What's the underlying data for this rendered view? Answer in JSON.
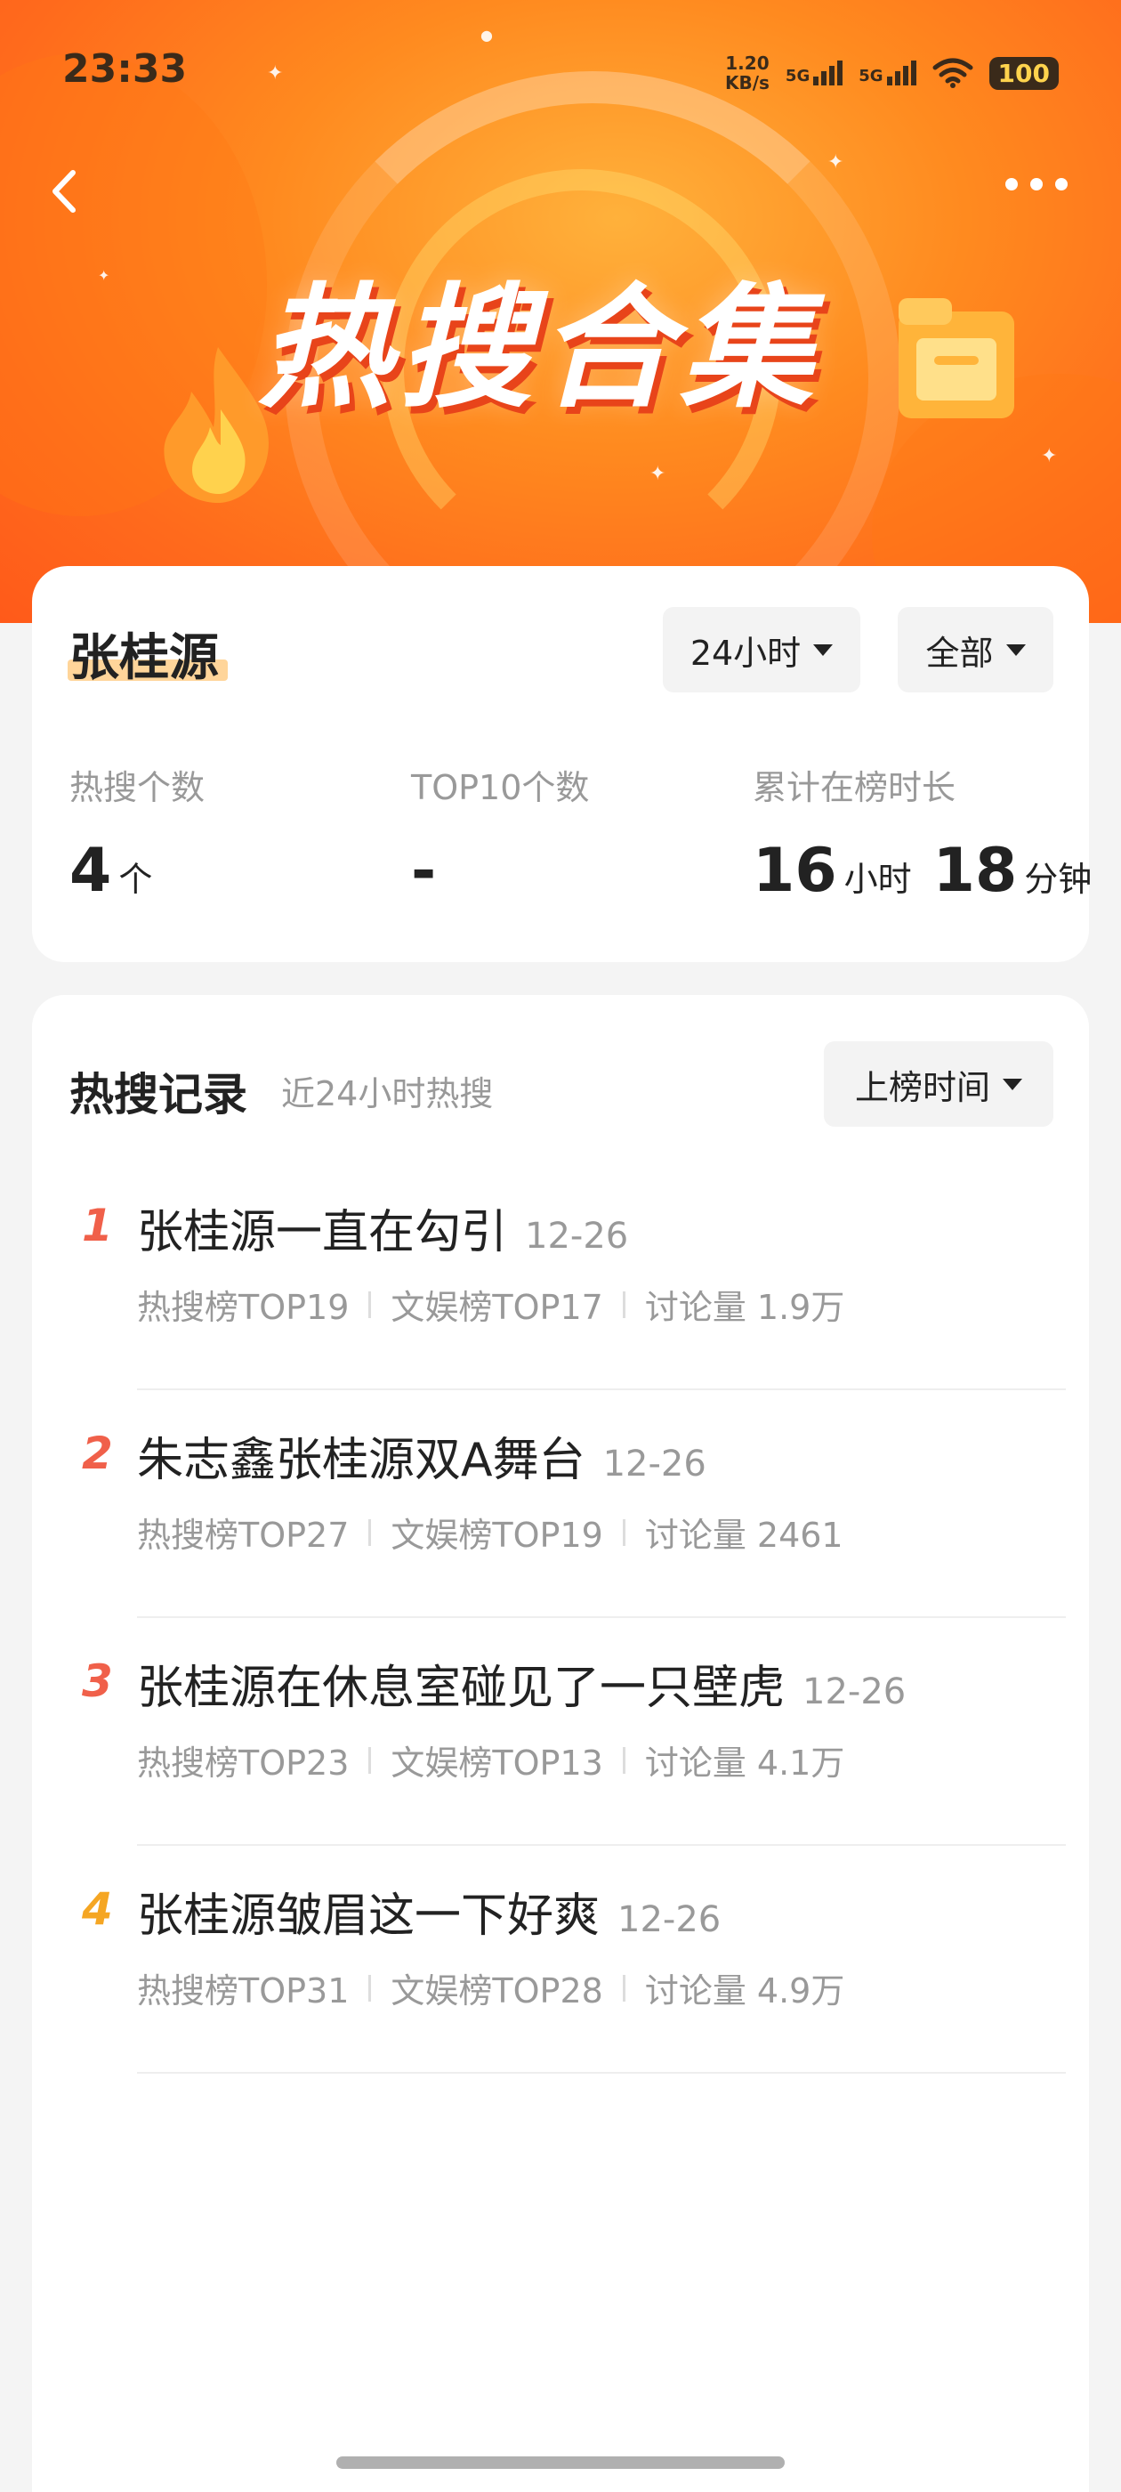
{
  "status_bar": {
    "time": "23:33",
    "net_speed_value": "1.20",
    "net_speed_unit": "KB/s",
    "signal1": "5G",
    "signal2": "5G",
    "battery": "100"
  },
  "banner": {
    "title": "热搜合集"
  },
  "summary": {
    "topic": "张桂源",
    "time_filter": "24小时",
    "category_filter": "全部",
    "stats": [
      {
        "label": "热搜个数",
        "value": "4",
        "unit": "个"
      },
      {
        "label": "TOP10个数",
        "value": "-",
        "unit": ""
      },
      {
        "label": "累计在榜时长",
        "hours": "16",
        "hours_unit": "小时",
        "minutes": "18",
        "minutes_unit": "分钟"
      }
    ]
  },
  "records": {
    "title": "热搜记录",
    "subtitle": "近24小时热搜",
    "sort_label": "上榜时间",
    "items": [
      {
        "rank": "1",
        "title": "张桂源一直在勾引",
        "date": "12-26",
        "hot_rank": "热搜榜TOP19",
        "ent_rank": "文娱榜TOP17",
        "discussion": "讨论量 1.9万"
      },
      {
        "rank": "2",
        "title": "朱志鑫张桂源双A舞台",
        "date": "12-26",
        "hot_rank": "热搜榜TOP27",
        "ent_rank": "文娱榜TOP19",
        "discussion": "讨论量 2461"
      },
      {
        "rank": "3",
        "title": "张桂源在休息室碰见了一只壁虎",
        "date": "12-26",
        "hot_rank": "热搜榜TOP23",
        "ent_rank": "文娱榜TOP13",
        "discussion": "讨论量 4.1万"
      },
      {
        "rank": "4",
        "title": "张桂源皱眉这一下好爽",
        "date": "12-26",
        "hot_rank": "热搜榜TOP31",
        "ent_rank": "文娱榜TOP28",
        "discussion": "讨论量 4.9万"
      }
    ]
  },
  "colors": {
    "rank_1": "#f0604a",
    "rank_2": "#f0604a",
    "rank_3": "#f0604a",
    "rank_4": "#f5a623",
    "banner_orange": "#ff7a1c"
  },
  "icons": {
    "back": "chevron-left-icon",
    "more": "more-dots-icon",
    "wifi": "wifi-icon",
    "caret": "caret-down-icon",
    "flame": "flame-icon",
    "folder": "folder-icon"
  }
}
